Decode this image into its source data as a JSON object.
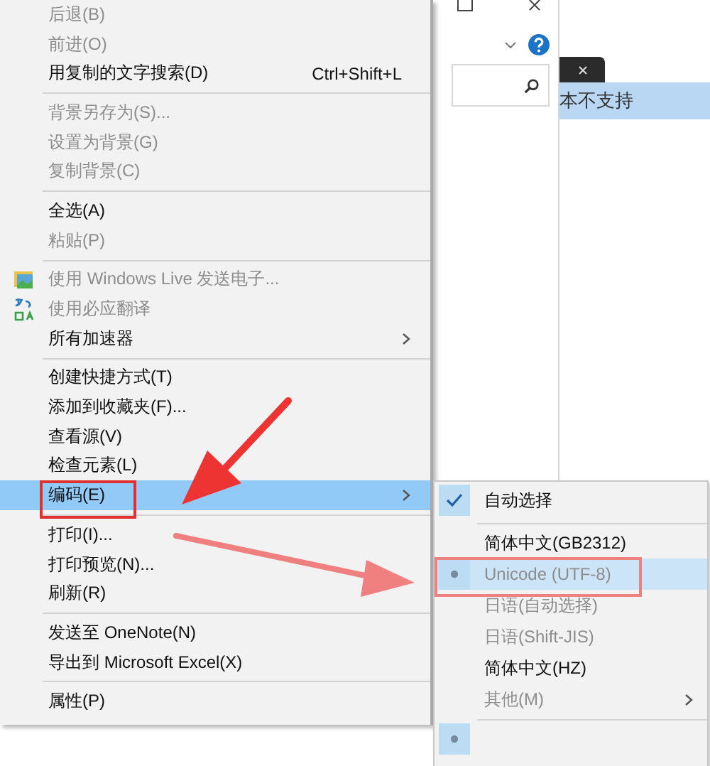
{
  "background_list": {
    "row_text": "本不支持",
    "selected": true
  },
  "menu": {
    "items": [
      {
        "kind": "item",
        "label": "后退(B)",
        "disabled": true,
        "selected": false
      },
      {
        "kind": "item",
        "label": "前进(O)",
        "disabled": true,
        "selected": false
      },
      {
        "kind": "item",
        "label": "用复制的文字搜索(D)",
        "shortcut": "Ctrl+Shift+L",
        "disabled": false,
        "selected": false
      },
      {
        "kind": "separator"
      },
      {
        "kind": "item",
        "label": "背景另存为(S)...",
        "disabled": true,
        "selected": false
      },
      {
        "kind": "item",
        "label": "设置为背景(G)",
        "disabled": true,
        "selected": false
      },
      {
        "kind": "item",
        "label": "复制背景(C)",
        "disabled": true,
        "selected": false
      },
      {
        "kind": "separator"
      },
      {
        "kind": "item",
        "label": "全选(A)",
        "disabled": false,
        "selected": false
      },
      {
        "kind": "item",
        "label": "粘贴(P)",
        "disabled": true,
        "selected": false
      },
      {
        "kind": "separator"
      },
      {
        "kind": "picture_item",
        "label": "使用 Windows Live 发送电子...",
        "disabled": true,
        "selected": false
      },
      {
        "kind": "translate_item",
        "label": "使用必应翻译",
        "disabled": true,
        "selected": false
      },
      {
        "kind": "item",
        "label": "所有加速器",
        "submenu": true,
        "disabled": false,
        "selected": false
      },
      {
        "kind": "separator"
      },
      {
        "kind": "item",
        "label": "创建快捷方式(T)",
        "disabled": false,
        "selected": false
      },
      {
        "kind": "item",
        "label": "添加到收藏夹(F)...",
        "disabled": false,
        "selected": false
      },
      {
        "kind": "item",
        "label": "查看源(V)",
        "disabled": false,
        "selected": false
      },
      {
        "kind": "item",
        "label": "检查元素(L)",
        "disabled": false,
        "selected": false
      },
      {
        "kind": "item",
        "label": "编码(E)",
        "submenu": true,
        "disabled": false,
        "selected": true
      },
      {
        "kind": "separator"
      },
      {
        "kind": "item",
        "label": "打印(I)...",
        "disabled": false,
        "selected": false
      },
      {
        "kind": "item",
        "label": "打印预览(N)...",
        "disabled": false,
        "selected": false
      },
      {
        "kind": "item",
        "label": "刷新(R)",
        "disabled": false,
        "selected": false
      },
      {
        "kind": "separator"
      },
      {
        "kind": "item",
        "label": "发送至 OneNote(N)",
        "disabled": false,
        "selected": false
      },
      {
        "kind": "item",
        "label": "导出到 Microsoft Excel(X)",
        "disabled": false,
        "selected": false
      },
      {
        "kind": "separator"
      },
      {
        "kind": "item",
        "label": "属性(P)",
        "disabled": false,
        "selected": false
      }
    ]
  },
  "submenu": {
    "items": [
      {
        "kind": "item",
        "label": "自动选择",
        "checked": true,
        "bullet": false,
        "disabled": false,
        "selected": false
      },
      {
        "kind": "separator"
      },
      {
        "kind": "item",
        "label": "简体中文(GB2312)",
        "checked": false,
        "bullet": false,
        "disabled": false,
        "selected": false
      },
      {
        "kind": "item",
        "label": "Unicode (UTF-8)",
        "checked": false,
        "bullet": true,
        "disabled": true,
        "selected": true
      },
      {
        "kind": "item",
        "label": "日语(自动选择)",
        "checked": false,
        "bullet": false,
        "disabled": true,
        "selected": false
      },
      {
        "kind": "item",
        "label": "日语(Shift-JIS)",
        "checked": false,
        "bullet": false,
        "disabled": true,
        "selected": false
      },
      {
        "kind": "item",
        "label": "简体中文(HZ)",
        "checked": false,
        "bullet": false,
        "disabled": false,
        "selected": false
      },
      {
        "kind": "item",
        "label": "其他(M)",
        "checked": false,
        "bullet": false,
        "submenu": true,
        "disabled": true,
        "selected": false
      },
      {
        "kind": "separator"
      },
      {
        "kind": "item",
        "checked": false,
        "bullet": true,
        "selected": false
      }
    ]
  }
}
